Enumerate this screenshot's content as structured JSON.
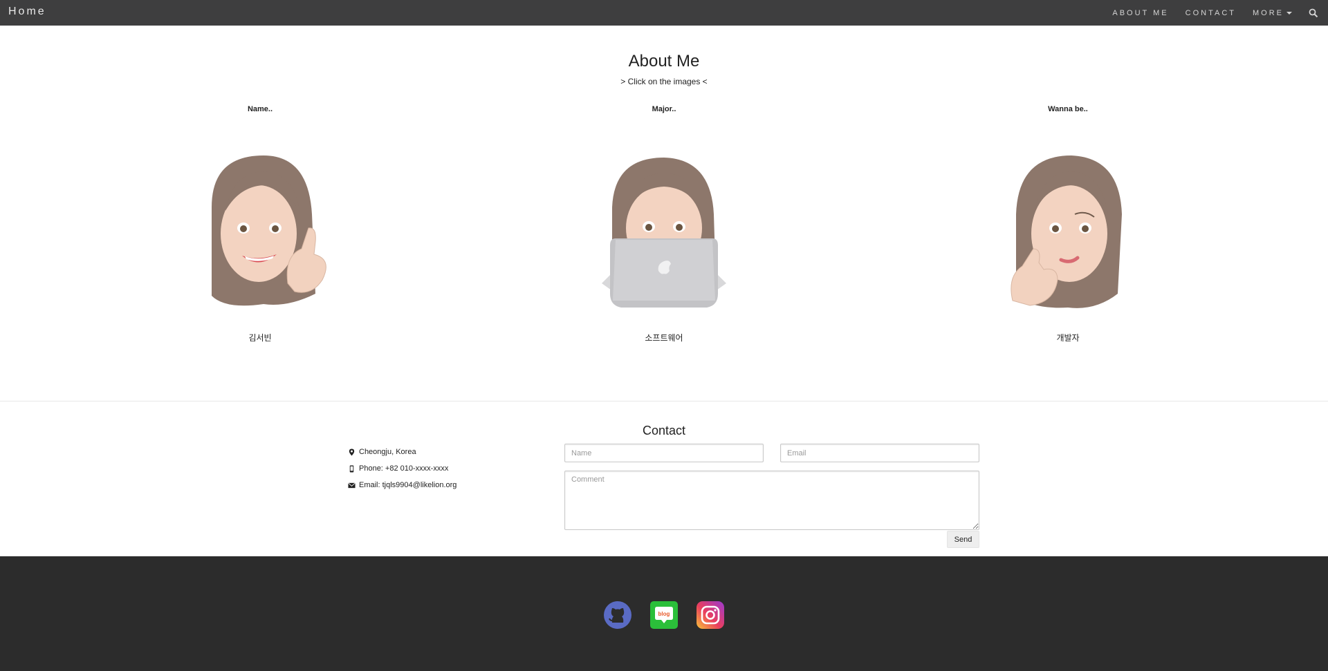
{
  "navbar": {
    "brand": "Home",
    "items": [
      {
        "label": "ABOUT ME"
      },
      {
        "label": "CONTACT"
      },
      {
        "label": "MORE"
      }
    ]
  },
  "about": {
    "title": "About Me",
    "subtitle": "> Click on the images <",
    "columns": [
      {
        "heading": "Name..",
        "caption": "김서빈"
      },
      {
        "heading": "Major..",
        "caption": "소프트웨어"
      },
      {
        "heading": "Wanna be..",
        "caption": "개발자"
      }
    ]
  },
  "contact": {
    "title": "Contact",
    "info": [
      {
        "icon": "map-marker-icon",
        "text": "Cheongju, Korea"
      },
      {
        "icon": "phone-icon",
        "text": "Phone: +82 010-xxxx-xxxx"
      },
      {
        "icon": "envelope-icon",
        "text": "Email: tjqls9904@likelion.org"
      }
    ],
    "form": {
      "name_placeholder": "Name",
      "email_placeholder": "Email",
      "comment_placeholder": "Comment",
      "send_label": "Send"
    }
  },
  "footer": {
    "icons": [
      "github-icon",
      "blog-icon",
      "instagram-icon"
    ],
    "blog_icon_text": "blog"
  },
  "colors": {
    "navbar_bg": "#3e3e3f",
    "footer_bg": "#2c2c2c",
    "github": "#5a6bc4",
    "blog": "#2bbf3a"
  }
}
